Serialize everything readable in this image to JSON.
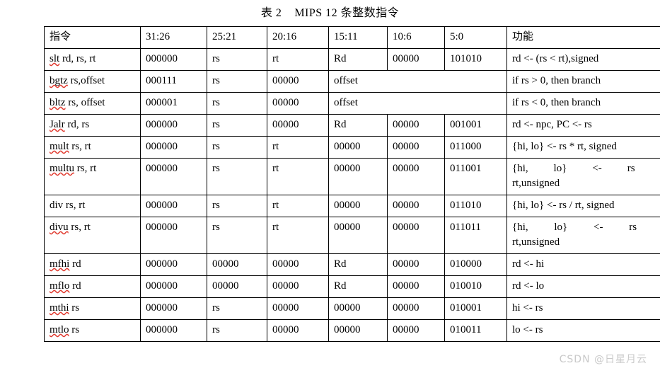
{
  "title": "表 2    MIPS 12 条整数指令",
  "watermark": "CSDN @日星月云",
  "table": {
    "headers": [
      "指令",
      "31:26",
      "25:21",
      "20:16",
      "15:11",
      "10:6",
      "5:0",
      "功能"
    ],
    "rows": [
      {
        "instruction": "slt rd, rs, rt",
        "misspelled": "slt",
        "rest": " rd, rs, rt",
        "f31_26": "000000",
        "f25_21": "rs",
        "f20_16": "rt",
        "f15_11": "Rd",
        "f10_6": "00000",
        "f5_0": "101010",
        "function": "rd <- (rs < rt),signed",
        "merged": false,
        "tall": false
      },
      {
        "instruction": "bgtz rs,offset",
        "misspelled": "bgtz",
        "rest": " rs,offset",
        "f31_26": "000111",
        "f25_21": "rs",
        "f20_16": "00000",
        "merged_value": "offset",
        "function": "if rs > 0, then branch",
        "merged": true,
        "tall": false
      },
      {
        "instruction": "bltz rs, offset",
        "misspelled": "bltz",
        "rest": " rs, offset",
        "f31_26": "000001",
        "f25_21": "rs",
        "f20_16": "00000",
        "merged_value": "offset",
        "function": "if rs < 0, then branch",
        "merged": true,
        "tall": false
      },
      {
        "instruction": "Jalr rd, rs",
        "misspelled": "Jalr",
        "rest": " rd, rs",
        "f31_26": "000000",
        "f25_21": "rs",
        "f20_16": "00000",
        "f15_11": "Rd",
        "f10_6": "00000",
        "f5_0": "001001",
        "function": "rd <- npc, PC <- rs",
        "merged": false,
        "tall": false
      },
      {
        "instruction": "mult rs, rt",
        "misspelled": "mult",
        "rest": " rs, rt",
        "f31_26": "000000",
        "f25_21": "rs",
        "f20_16": "rt",
        "f15_11": "00000",
        "f10_6": "00000",
        "f5_0": "011000",
        "function": "{hi, lo} <- rs * rt, signed",
        "merged": false,
        "tall": false
      },
      {
        "instruction": "multu rs, rt",
        "misspelled": "multu",
        "rest": " rs, rt",
        "f31_26": "000000",
        "f25_21": "rs",
        "f20_16": "rt",
        "f15_11": "00000",
        "f10_6": "00000",
        "f5_0": "011001",
        "function_line1": "{hi, lo} <- rs *",
        "function_line2": "rt,unsigned",
        "function": "{hi, lo} <- rs * rt,unsigned",
        "merged": false,
        "tall": true
      },
      {
        "instruction": "div rs, rt",
        "misspelled": "",
        "rest": "div rs, rt",
        "f31_26": "000000",
        "f25_21": "rs",
        "f20_16": "rt",
        "f15_11": "00000",
        "f10_6": "00000",
        "f5_0": "011010",
        "function": "{hi, lo} <- rs / rt, signed",
        "merged": false,
        "tall": false
      },
      {
        "instruction": "divu rs, rt",
        "misspelled": "divu",
        "rest": " rs, rt",
        "f31_26": "000000",
        "f25_21": "rs",
        "f20_16": "rt",
        "f15_11": "00000",
        "f10_6": "00000",
        "f5_0": "011011",
        "function_line1": "{hi, lo} <- rs /",
        "function_line2": "rt,unsigned",
        "function": "{hi, lo} <- rs / rt,unsigned",
        "merged": false,
        "tall": true
      },
      {
        "instruction": "mfhi rd",
        "misspelled": "mfhi",
        "rest": " rd",
        "f31_26": "000000",
        "f25_21": "00000",
        "f20_16": "00000",
        "f15_11": "Rd",
        "f10_6": "00000",
        "f5_0": "010000",
        "function": "rd <- hi",
        "merged": false,
        "tall": false
      },
      {
        "instruction": "mflo rd",
        "misspelled": "mflo",
        "rest": " rd",
        "f31_26": "000000",
        "f25_21": "00000",
        "f20_16": "00000",
        "f15_11": "Rd",
        "f10_6": "00000",
        "f5_0": "010010",
        "function": "rd <- lo",
        "merged": false,
        "tall": false
      },
      {
        "instruction": "mthi rs",
        "misspelled": "mthi",
        "rest": " rs",
        "f31_26": "000000",
        "f25_21": "rs",
        "f20_16": "00000",
        "f15_11": "00000",
        "f10_6": "00000",
        "f5_0": "010001",
        "function": "hi <- rs",
        "merged": false,
        "tall": false
      },
      {
        "instruction": "mtlo rs",
        "misspelled": "mtlo",
        "rest": " rs",
        "f31_26": "000000",
        "f25_21": "rs",
        "f20_16": "00000",
        "f15_11": "00000",
        "f10_6": "00000",
        "f5_0": "010011",
        "function": "lo <- rs",
        "merged": false,
        "tall": false
      }
    ]
  }
}
